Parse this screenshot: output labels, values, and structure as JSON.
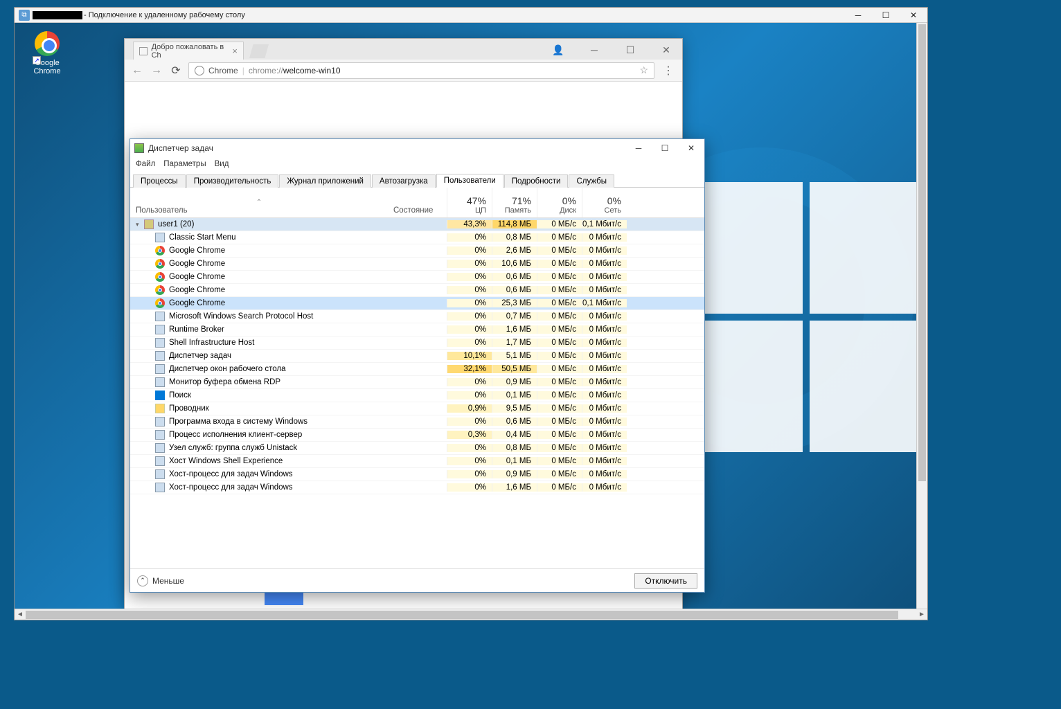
{
  "rdp": {
    "title_suffix": "- Подключение к удаленному рабочему столу"
  },
  "desktop": {
    "chrome_label": "Google Chrome"
  },
  "chrome": {
    "tab_title": "Добро пожаловать в Ch",
    "addr_label": "Chrome",
    "url_dim": "chrome://",
    "url_strong": "welcome-win10"
  },
  "taskmgr": {
    "title": "Диспетчер задач",
    "menu": {
      "file": "Файл",
      "options": "Параметры",
      "view": "Вид"
    },
    "tabs": [
      "Процессы",
      "Производительность",
      "Журнал приложений",
      "Автозагрузка",
      "Пользователи",
      "Подробности",
      "Службы"
    ],
    "active_tab": 4,
    "headers": {
      "user": "Пользователь",
      "status": "Состояние",
      "cpu_pct": "47%",
      "cpu": "ЦП",
      "mem_pct": "71%",
      "mem": "Память",
      "disk_pct": "0%",
      "disk": "Диск",
      "net_pct": "0%",
      "net": "Сеть"
    },
    "user_row": {
      "name": "user1 (20)",
      "cpu": "43,3%",
      "mem": "114,8 МБ",
      "disk": "0 МБ/с",
      "net": "0,1 Мбит/с"
    },
    "rows": [
      {
        "icon": "gen",
        "name": "Classic Start Menu",
        "cpu": "0%",
        "mem": "0,8 МБ",
        "disk": "0 МБ/с",
        "net": "0 Мбит/с"
      },
      {
        "icon": "chrome",
        "name": "Google Chrome",
        "cpu": "0%",
        "mem": "2,6 МБ",
        "disk": "0 МБ/с",
        "net": "0 Мбит/с"
      },
      {
        "icon": "chrome",
        "name": "Google Chrome",
        "cpu": "0%",
        "mem": "10,6 МБ",
        "disk": "0 МБ/с",
        "net": "0 Мбит/с"
      },
      {
        "icon": "chrome",
        "name": "Google Chrome",
        "cpu": "0%",
        "mem": "0,6 МБ",
        "disk": "0 МБ/с",
        "net": "0 Мбит/с"
      },
      {
        "icon": "chrome",
        "name": "Google Chrome",
        "cpu": "0%",
        "mem": "0,6 МБ",
        "disk": "0 МБ/с",
        "net": "0 Мбит/с"
      },
      {
        "icon": "chrome",
        "name": "Google Chrome",
        "cpu": "0%",
        "mem": "25,3 МБ",
        "disk": "0 МБ/с",
        "net": "0,1 Мбит/с",
        "selected": true
      },
      {
        "icon": "gen",
        "name": "Microsoft Windows Search Protocol Host",
        "cpu": "0%",
        "mem": "0,7 МБ",
        "disk": "0 МБ/с",
        "net": "0 Мбит/с"
      },
      {
        "icon": "gen",
        "name": "Runtime Broker",
        "cpu": "0%",
        "mem": "1,6 МБ",
        "disk": "0 МБ/с",
        "net": "0 Мбит/с"
      },
      {
        "icon": "gen",
        "name": "Shell Infrastructure Host",
        "cpu": "0%",
        "mem": "1,7 МБ",
        "disk": "0 МБ/с",
        "net": "0 Мбит/с"
      },
      {
        "icon": "gen",
        "name": "Диспетчер задач",
        "cpu": "10,1%",
        "mem": "5,1 МБ",
        "disk": "0 МБ/с",
        "net": "0 Мбит/с",
        "cpuheat": 2
      },
      {
        "icon": "gen",
        "name": "Диспетчер окон рабочего стола",
        "cpu": "32,1%",
        "mem": "50,5 МБ",
        "disk": "0 МБ/с",
        "net": "0 Мбит/с",
        "cpuheat": 3,
        "memheat": 2
      },
      {
        "icon": "gen",
        "name": "Монитор буфера обмена RDP",
        "cpu": "0%",
        "mem": "0,9 МБ",
        "disk": "0 МБ/с",
        "net": "0 Мбит/с"
      },
      {
        "icon": "search",
        "name": "Поиск",
        "cpu": "0%",
        "mem": "0,1 МБ",
        "disk": "0 МБ/с",
        "net": "0 Мбит/с"
      },
      {
        "icon": "folder",
        "name": "Проводник",
        "cpu": "0,9%",
        "mem": "9,5 МБ",
        "disk": "0 МБ/с",
        "net": "0 Мбит/с",
        "cpuheat": 1
      },
      {
        "icon": "gen",
        "name": "Программа входа в систему Windows",
        "cpu": "0%",
        "mem": "0,6 МБ",
        "disk": "0 МБ/с",
        "net": "0 Мбит/с"
      },
      {
        "icon": "gen",
        "name": "Процесс исполнения клиент-сервер",
        "cpu": "0,3%",
        "mem": "0,4 МБ",
        "disk": "0 МБ/с",
        "net": "0 Мбит/с",
        "cpuheat": 1
      },
      {
        "icon": "gen",
        "name": "Узел служб: группа служб Unistack",
        "cpu": "0%",
        "mem": "0,8 МБ",
        "disk": "0 МБ/с",
        "net": "0 Мбит/с"
      },
      {
        "icon": "gen",
        "name": "Хост Windows Shell Experience",
        "cpu": "0%",
        "mem": "0,1 МБ",
        "disk": "0 МБ/с",
        "net": "0 Мбит/с"
      },
      {
        "icon": "gen",
        "name": "Хост-процесс для задач Windows",
        "cpu": "0%",
        "mem": "0,9 МБ",
        "disk": "0 МБ/с",
        "net": "0 Мбит/с"
      },
      {
        "icon": "gen",
        "name": "Хост-процесс для задач Windows",
        "cpu": "0%",
        "mem": "1,6 МБ",
        "disk": "0 МБ/с",
        "net": "0 Мбит/с"
      }
    ],
    "fewer": "Меньше",
    "disconnect": "Отключить"
  }
}
